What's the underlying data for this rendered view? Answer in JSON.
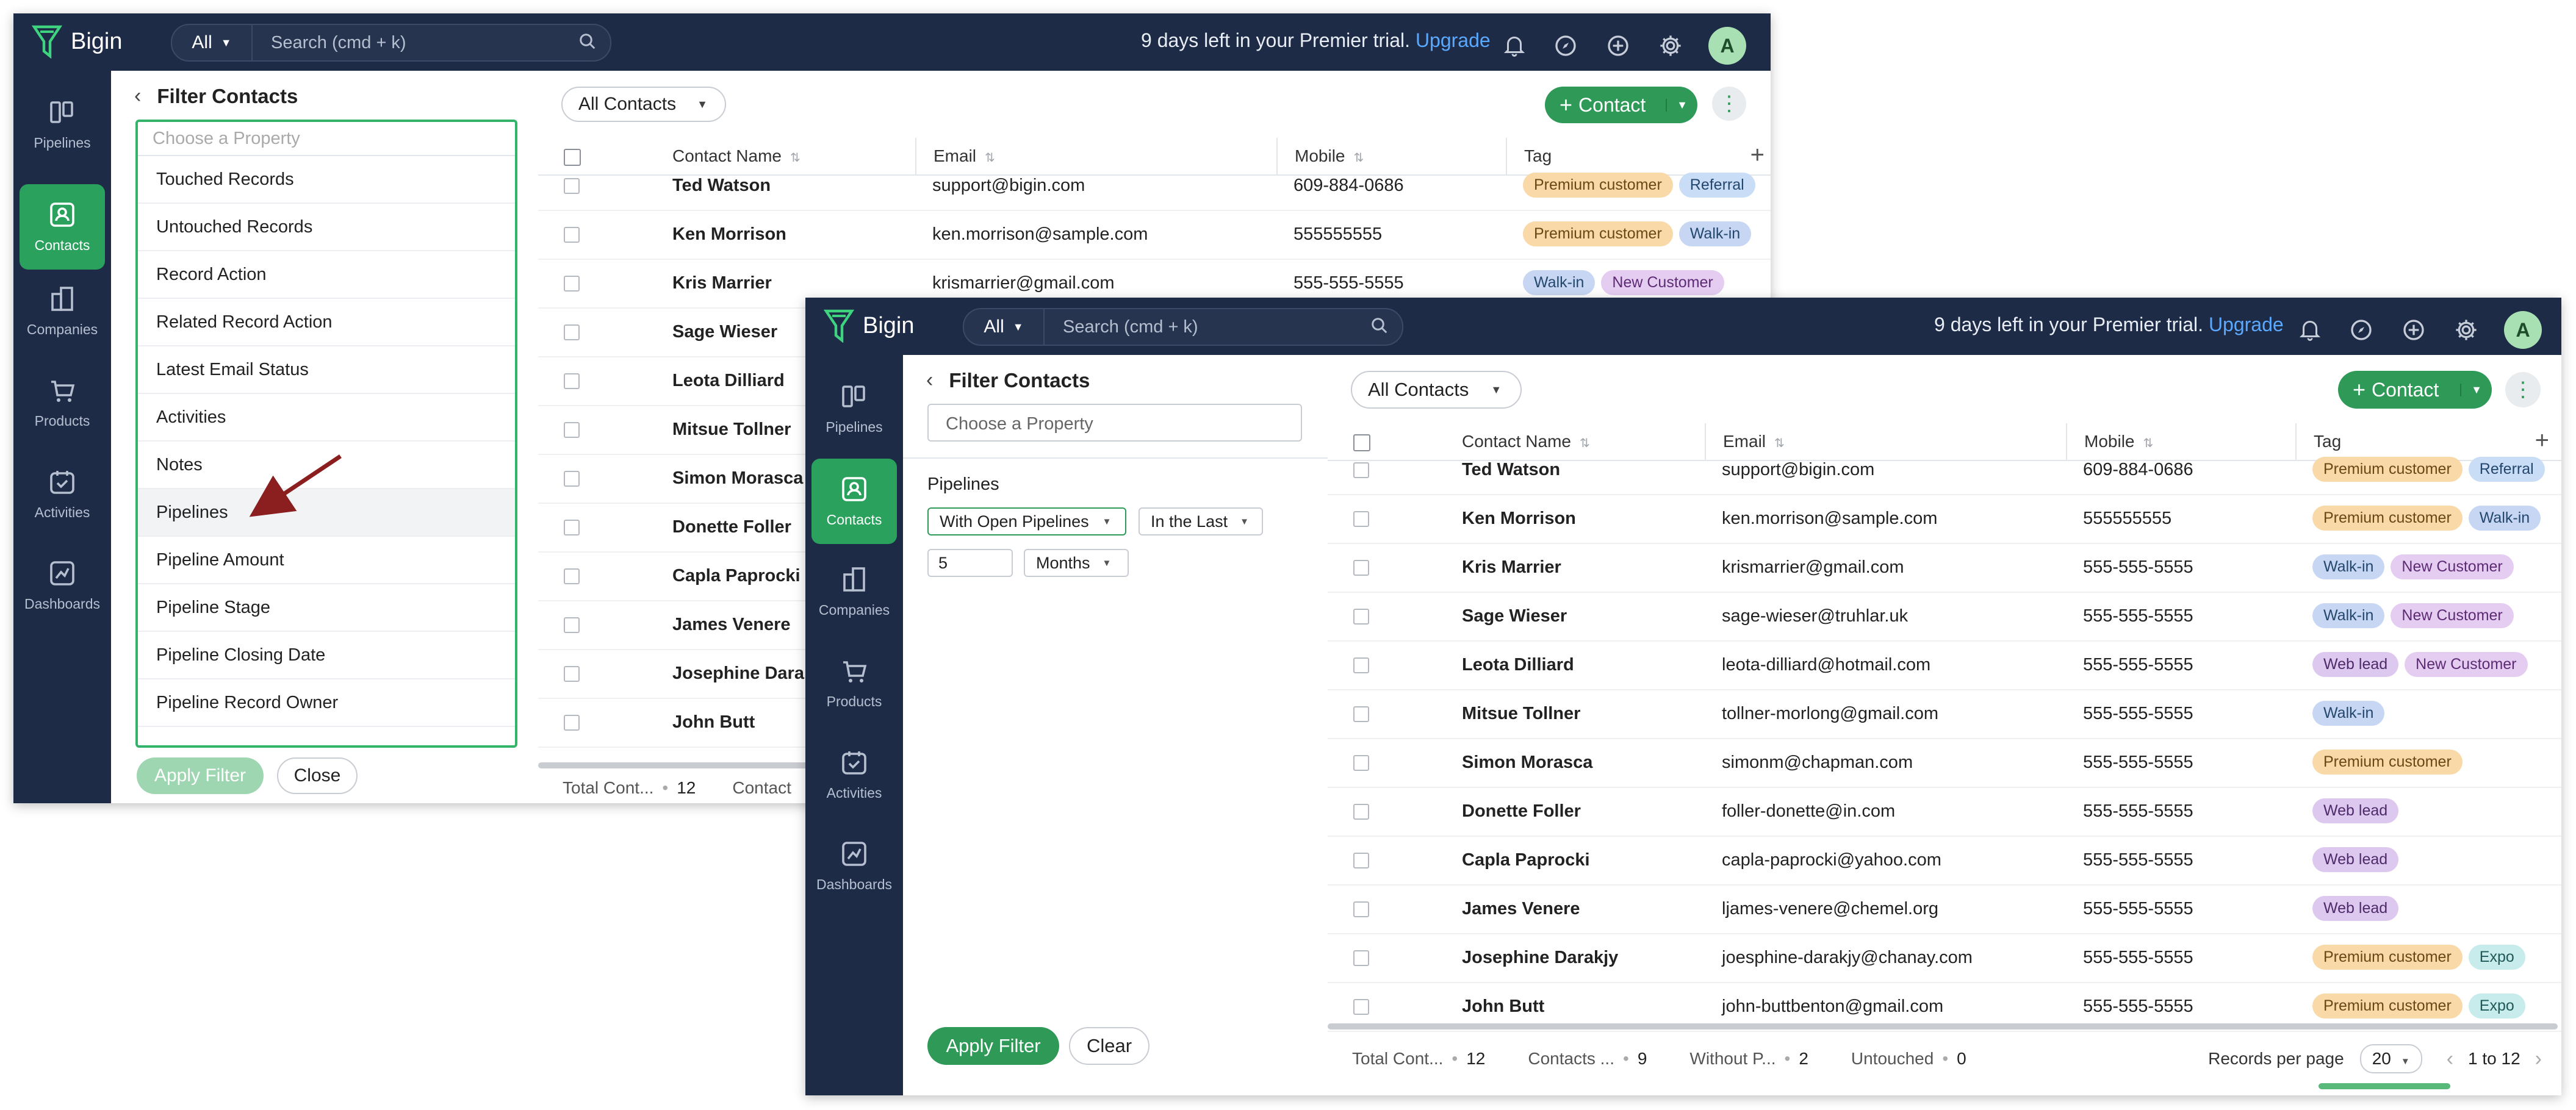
{
  "app": {
    "name": "Bigin"
  },
  "topbar": {
    "search_scope": "All",
    "search_placeholder": "Search (cmd + k)",
    "trial_text": "9 days left in your Premier trial.",
    "upgrade_label": "Upgrade",
    "avatar_initial": "A"
  },
  "sidebar": {
    "items": [
      {
        "label": "Pipelines",
        "icon": "pipelines-icon"
      },
      {
        "label": "Contacts",
        "icon": "contacts-icon"
      },
      {
        "label": "Companies",
        "icon": "companies-icon"
      },
      {
        "label": "Products",
        "icon": "products-icon"
      },
      {
        "label": "Activities",
        "icon": "activities-icon"
      },
      {
        "label": "Dashboards",
        "icon": "dashboards-icon"
      }
    ],
    "active": "Contacts"
  },
  "filter": {
    "title": "Filter Contacts",
    "property_placeholder": "Choose a Property",
    "property_options": [
      "Touched Records",
      "Untouched Records",
      "Record Action",
      "Related Record Action",
      "Latest Email Status",
      "Activities",
      "Notes",
      "Pipelines",
      "Pipeline Amount",
      "Pipeline Stage",
      "Pipeline Closing Date",
      "Pipeline Record Owner"
    ],
    "highlighted_option": "Pipelines",
    "apply_label": "Apply Filter",
    "close_label": "Close",
    "clear_label": "Clear",
    "section_label": "Pipelines",
    "condition": "With Open Pipelines",
    "period_mode": "In the Last",
    "period_value": "5",
    "period_unit": "Months"
  },
  "view": {
    "selector_label": "All Contacts",
    "add_contact_label": "Contact"
  },
  "table": {
    "columns": [
      "Contact Name",
      "Email",
      "Mobile",
      "Tag"
    ],
    "rows": [
      {
        "name": "Ted Watson",
        "email": "support@bigin.com",
        "mobile": "609-884-0686",
        "tags": [
          "Premium customer",
          "Referral"
        ]
      },
      {
        "name": "Ken Morrison",
        "email": "ken.morrison@sample.com",
        "mobile": "555555555",
        "tags": [
          "Premium customer",
          "Walk-in"
        ]
      },
      {
        "name": "Kris Marrier",
        "email": "krismarrier@gmail.com",
        "mobile": "555-555-5555",
        "tags": [
          "Walk-in",
          "New Customer"
        ]
      },
      {
        "name": "Sage Wieser",
        "email": "sage-wieser@truhlar.uk",
        "mobile": "555-555-5555",
        "tags": [
          "Walk-in",
          "New Customer"
        ]
      },
      {
        "name": "Leota Dilliard",
        "email": "leota-dilliard@hotmail.com",
        "mobile": "555-555-5555",
        "tags": [
          "Web lead",
          "New Customer"
        ]
      },
      {
        "name": "Mitsue Tollner",
        "email": "tollner-morlong@gmail.com",
        "mobile": "555-555-5555",
        "tags": [
          "Walk-in"
        ]
      },
      {
        "name": "Simon Morasca",
        "email": "simonm@chapman.com",
        "mobile": "555-555-5555",
        "tags": [
          "Premium customer"
        ]
      },
      {
        "name": "Donette Foller",
        "email": "foller-donette@in.com",
        "mobile": "555-555-5555",
        "tags": [
          "Web lead"
        ]
      },
      {
        "name": "Capla Paprocki",
        "email": "capla-paprocki@yahoo.com",
        "mobile": "555-555-5555",
        "tags": [
          "Web lead"
        ]
      },
      {
        "name": "James Venere",
        "email": "ljames-venere@chemel.org",
        "mobile": "555-555-5555",
        "tags": [
          "Web lead"
        ]
      },
      {
        "name": "Josephine Darakjy",
        "email": "joesphine-darakjy@chanay.com",
        "mobile": "555-555-5555",
        "tags": [
          "Premium customer",
          "Expo"
        ]
      },
      {
        "name": "John Butt",
        "email": "john-buttbenton@gmail.com",
        "mobile": "555-555-5555",
        "tags": [
          "Premium customer",
          "Expo"
        ]
      }
    ],
    "back_rows": [
      {
        "name": "Ted Watson",
        "email": "support@bigin.com",
        "mobile": "609-884-0686",
        "tags": [
          "Premium customer",
          "Referral"
        ]
      },
      {
        "name": "Ken Morrison",
        "email": "ken.morrison@sample.com",
        "mobile": "555555555",
        "tags": [
          "Premium customer",
          "Walk-in"
        ]
      },
      {
        "name": "Kris Marrier",
        "email": "krismarrier@gmail.com",
        "mobile": "555-555-5555",
        "tags": [
          "Walk-in",
          "New Customer"
        ]
      },
      {
        "name": "Sage Wieser"
      },
      {
        "name": "Leota Dilliard"
      },
      {
        "name": "Mitsue Tollner"
      },
      {
        "name": "Simon Morasca"
      },
      {
        "name": "Donette Foller"
      },
      {
        "name": "Capla Paprocki"
      },
      {
        "name": "James Venere"
      },
      {
        "name": "Josephine Darak"
      },
      {
        "name": "John Butt"
      }
    ]
  },
  "footer": {
    "stats": [
      {
        "label": "Total Cont...",
        "value": "12"
      },
      {
        "label": "Contacts ...",
        "value": "9"
      },
      {
        "label": "Without P...",
        "value": "2"
      },
      {
        "label": "Untouched",
        "value": "0"
      }
    ],
    "back_stats": [
      {
        "label": "Total Cont...",
        "value": "12"
      },
      {
        "label": "Contact",
        "value": ""
      }
    ],
    "records_per_page_label": "Records per page",
    "records_per_page": "20",
    "range": "1 to 12"
  },
  "colors": {
    "nav": "#1d2b47",
    "accent": "#2f9a58",
    "link": "#5aa9ff",
    "arrow": "#8b1e1e"
  }
}
